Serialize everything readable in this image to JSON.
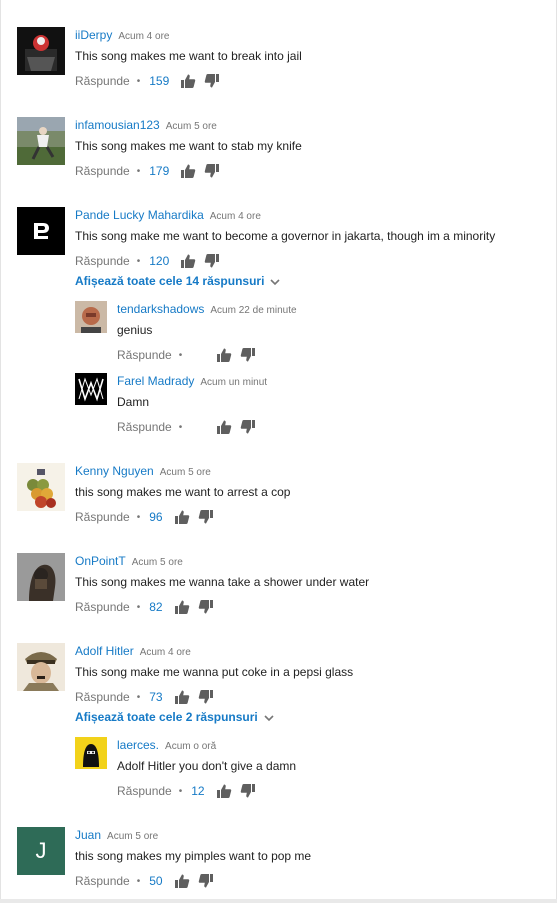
{
  "labels": {
    "reply": "Răspunde"
  },
  "colors": {
    "link": "#167ac6",
    "muted": "#767676",
    "text": "#222222",
    "icon": "#5f5f5f"
  },
  "comments": [
    {
      "author": "iiDerpy",
      "time": "Acum 4 ore",
      "text": "This song makes me want to break into jail",
      "likes": "159"
    },
    {
      "author": "infamousian123",
      "time": "Acum 5 ore",
      "text": "This song makes me want to stab my knife",
      "likes": "179"
    },
    {
      "author": "Pande Lucky Mahardika",
      "time": "Acum 4 ore",
      "text": "This song make me want to become a governor in jakarta, though im a minority",
      "likes": "120",
      "view_replies": "Afișează toate cele 14 răspunsuri",
      "replies": [
        {
          "author": "tendarkshadows",
          "time": "Acum 22 de minute",
          "text": "genius",
          "likes": ""
        },
        {
          "author": "Farel Madrady",
          "time": "Acum un minut",
          "text": "Damn",
          "likes": ""
        }
      ]
    },
    {
      "author": "Kenny Nguyen",
      "time": "Acum 5 ore",
      "text": "this song makes me want to arrest a cop",
      "likes": "96"
    },
    {
      "author": "OnPointT",
      "time": "Acum 5 ore",
      "text": "This song makes me wanna take a shower under water",
      "likes": "82"
    },
    {
      "author": "Adolf Hitler",
      "time": "Acum 4 ore",
      "text": "This song make me wanna put coke in a pepsi glass",
      "likes": "73",
      "view_replies": "Afișează toate cele 2 răspunsuri",
      "replies": [
        {
          "author": "laerces.",
          "time": "Acum o oră",
          "text": "Adolf Hitler you don't give a damn",
          "likes": "12"
        }
      ]
    },
    {
      "author": "Juan",
      "time": "Acum 5 ore",
      "avatar_letter": "J",
      "text": "this song makes my pimples want to pop me",
      "likes": "50"
    }
  ]
}
